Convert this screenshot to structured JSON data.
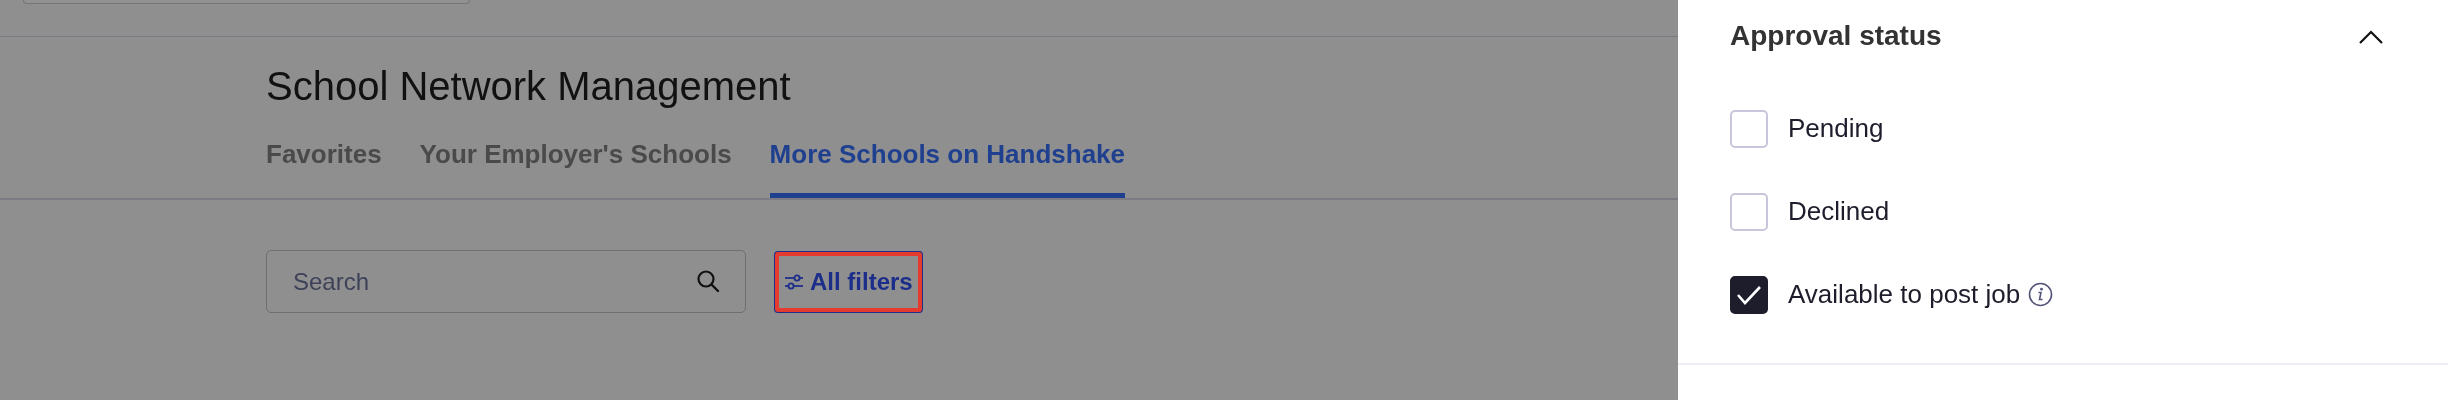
{
  "page": {
    "title": "School Network Management",
    "tabs": [
      {
        "label": "Favorites",
        "selected": false
      },
      {
        "label": "Your Employer's Schools",
        "selected": false
      },
      {
        "label": "More Schools on Handshake",
        "selected": true
      }
    ],
    "search": {
      "placeholder": "Search"
    },
    "filters_button": {
      "label": "All filters",
      "highlighted": true
    }
  },
  "filter_panel": {
    "section": {
      "title": "Approval status",
      "expanded": true,
      "options": [
        {
          "label": "Pending",
          "checked": false,
          "info": false
        },
        {
          "label": "Declined",
          "checked": false,
          "info": false
        },
        {
          "label": "Available to post job",
          "checked": true,
          "info": true
        }
      ]
    }
  }
}
